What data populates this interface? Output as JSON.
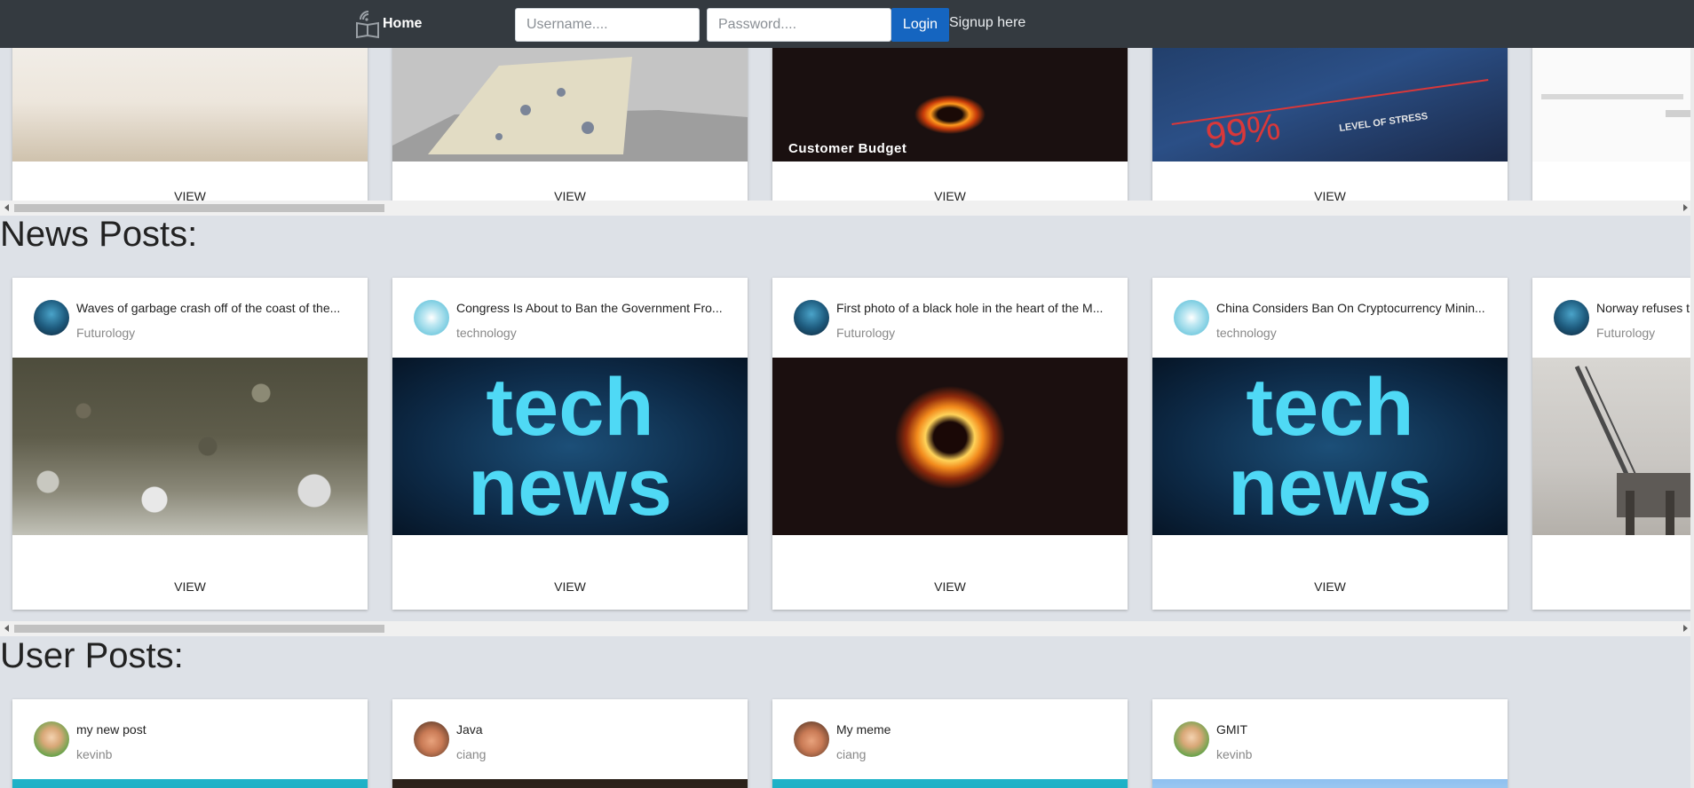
{
  "navbar": {
    "brand": "Home",
    "username_placeholder": "Username....",
    "password_placeholder": "Password....",
    "login_label": "Login",
    "signup_label": "Signup here"
  },
  "top_row": {
    "cards": [
      {
        "view_label": "VIEW"
      },
      {
        "view_label": "VIEW"
      },
      {
        "view_label": "VIEW",
        "image_caption": "Customer Budget"
      },
      {
        "view_label": "VIEW",
        "image_caption": "99%",
        "image_caption2": "LEVEL OF STRESS"
      }
    ]
  },
  "news": {
    "title": "News Posts:",
    "cards": [
      {
        "title": "Waves of garbage crash off of the coast of the...",
        "sub": "Futurology",
        "view_label": "VIEW"
      },
      {
        "title": "Congress Is About to Ban the Government Fro...",
        "sub": "technology",
        "view_label": "VIEW",
        "image_word1": "tech",
        "image_word2": "news"
      },
      {
        "title": "First photo of a black hole in the heart of the M...",
        "sub": "Futurology",
        "view_label": "VIEW"
      },
      {
        "title": "China Considers Ban On Cryptocurrency Minin...",
        "sub": "technology",
        "view_label": "VIEW",
        "image_word1": "tech",
        "image_word2": "news"
      },
      {
        "title": "Norway refuses t",
        "sub": "Futurology"
      }
    ]
  },
  "user": {
    "title": "User Posts:",
    "cards": [
      {
        "title": "my new post",
        "sub": "kevinb"
      },
      {
        "title": "Java",
        "sub": "ciang"
      },
      {
        "title": "My meme",
        "sub": "ciang"
      },
      {
        "title": "GMIT",
        "sub": "kevinb"
      }
    ]
  },
  "colors": {
    "navbar": "#343a40",
    "login": "#1565c0",
    "page_bg": "#dde1e7"
  }
}
